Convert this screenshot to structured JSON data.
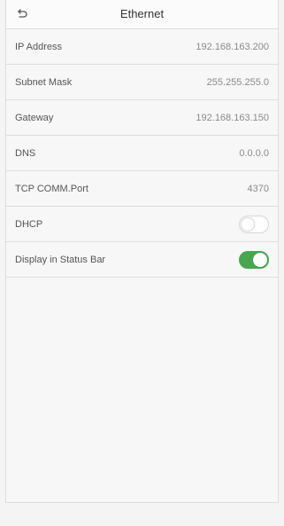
{
  "header": {
    "title": "Ethernet",
    "back_icon": "back-arrow-icon"
  },
  "settings": {
    "items": [
      {
        "label": "IP Address",
        "value": "192.168.163.200"
      },
      {
        "label": "Subnet Mask",
        "value": "255.255.255.0"
      },
      {
        "label": "Gateway",
        "value": "192.168.163.150"
      },
      {
        "label": "DNS",
        "value": "0.0.0.0"
      },
      {
        "label": "TCP COMM.Port",
        "value": "4370"
      }
    ],
    "toggles": [
      {
        "label": "DHCP",
        "state": "off"
      },
      {
        "label": "Display in Status Bar",
        "state": "on"
      }
    ]
  },
  "colors": {
    "accent_green": "#45a84c",
    "background": "#f7f7f7",
    "divider": "#dedede"
  }
}
